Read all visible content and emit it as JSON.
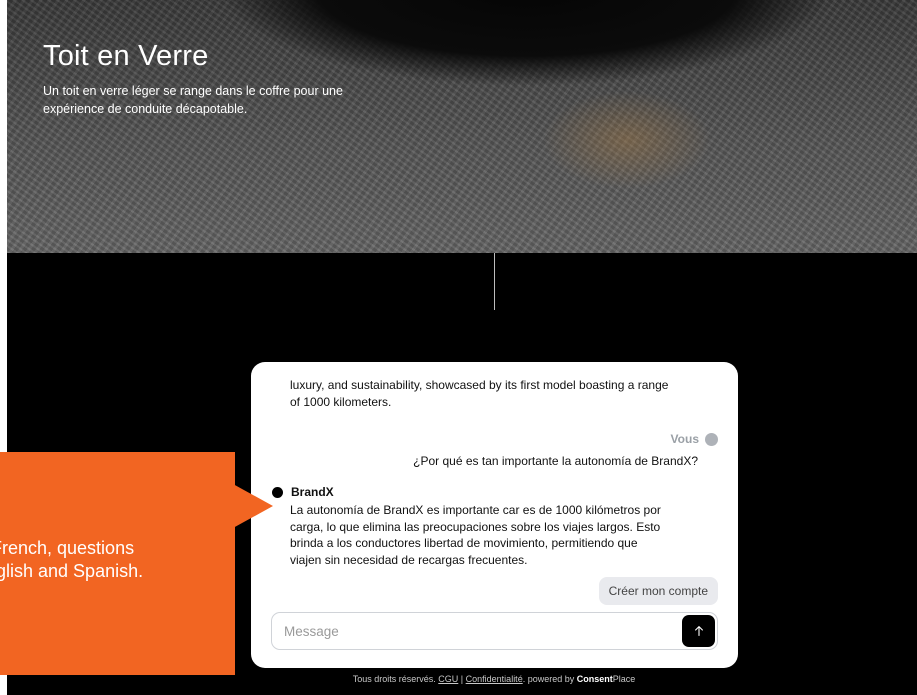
{
  "hero": {
    "title": "Toit en Verre",
    "subtitle": "Un toit en verre léger se range dans le coffre pour une expérience de conduite décapotable."
  },
  "chat": {
    "bot_continued_text": "luxury, and sustainability, showcased by its first model boasting a range of 1000 kilometers.",
    "user_label": "Vous",
    "user_message": "¿Por qué es tan importante la autonomía de BrandX?",
    "bot_label": "BrandX",
    "bot_answer": "La autonomía de BrandX es importante car es de 1000 kilómetros por carga, lo que elimina las preocupaciones sobre los viajes largos. Esto brinda a los conductores libertad de movimiento, permitiendo que viajen sin necesidad de recargas frecuentes.",
    "cta_label": "Créer mon compte",
    "input_placeholder": "Message",
    "send_icon": "arrow-up-icon"
  },
  "footer": {
    "rights": "Tous droits réservés.",
    "cgu": "CGU",
    "separator": "|",
    "privacy": "Confidentialité",
    "powered_by": ". powered by",
    "brand_bold": "Consent",
    "brand_rest": "Place"
  },
  "callout": {
    "line1": "French, questions",
    "line2": "glish and Spanish."
  },
  "colors": {
    "callout": "#f26522",
    "panel": "#ffffff",
    "send_button": "#000000"
  }
}
